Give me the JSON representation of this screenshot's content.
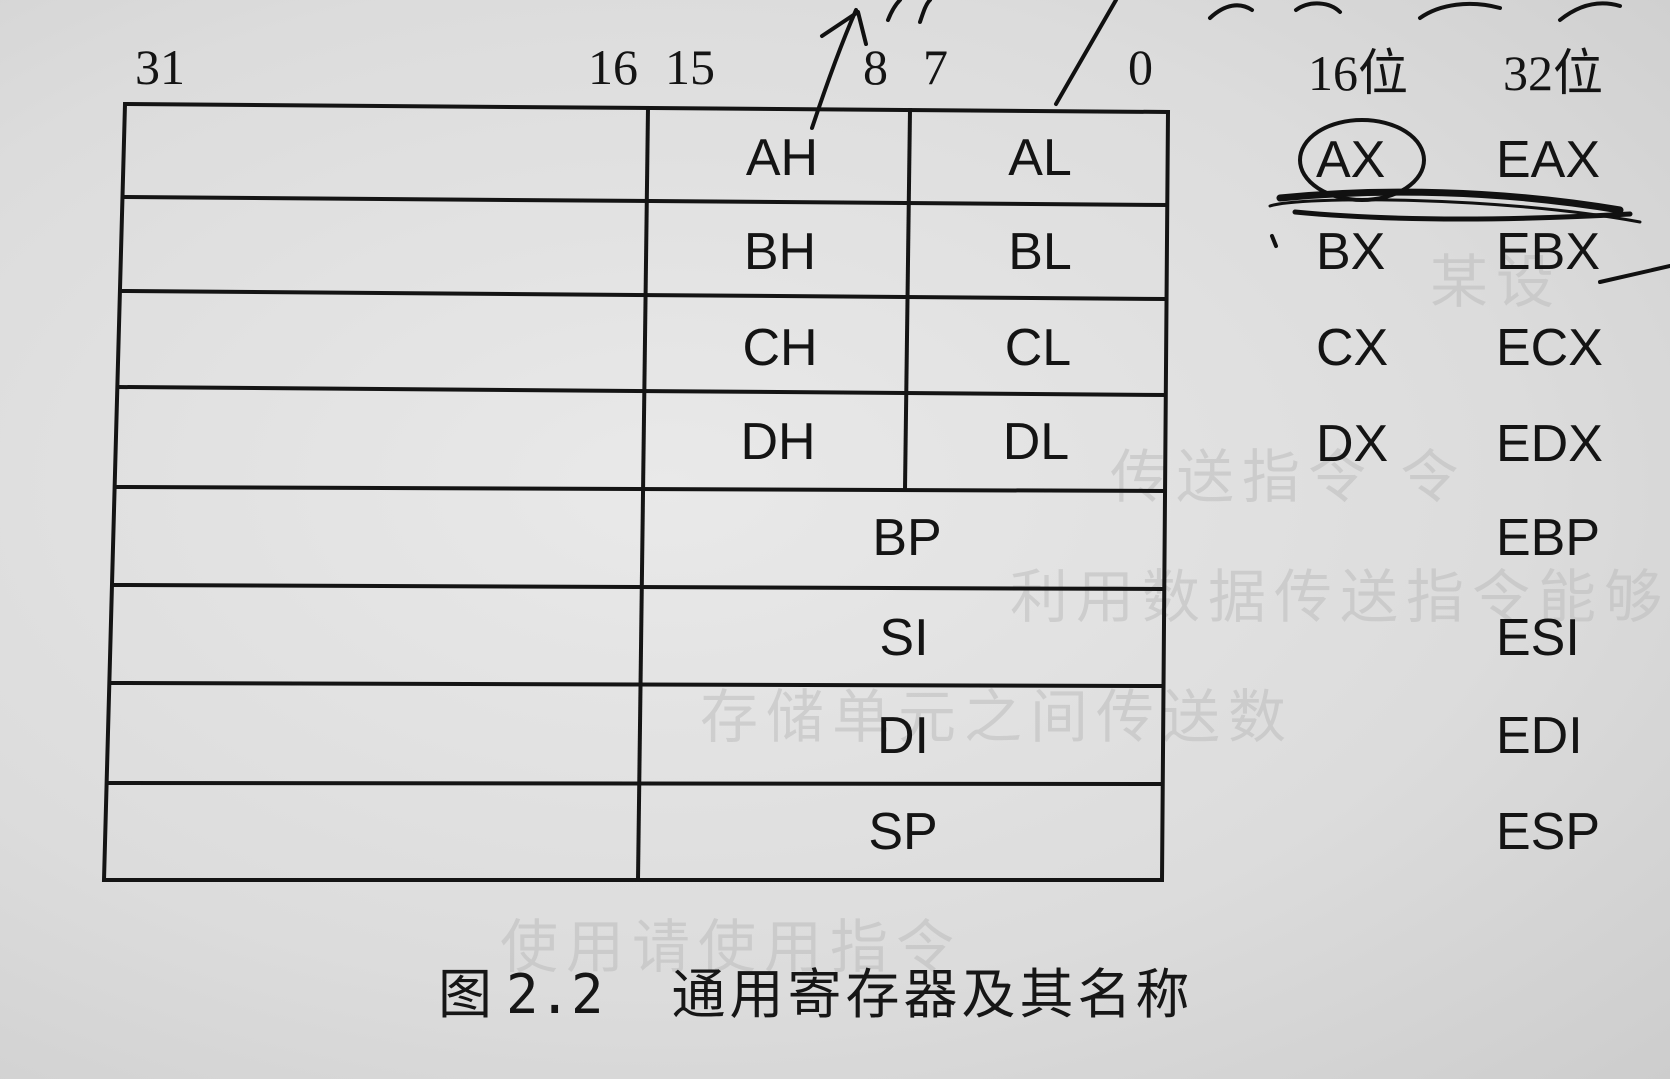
{
  "bit_labels": {
    "b31": "31",
    "b16": "16",
    "b15": "15",
    "b8": "8",
    "b7": "7",
    "b0": "0"
  },
  "headers": {
    "col16": "16位",
    "col32": "32位"
  },
  "registers": {
    "ax": {
      "high": "AH",
      "low": "AL",
      "name16": "AX",
      "name32": "EAX"
    },
    "bx": {
      "high": "BH",
      "low": "BL",
      "name16": "BX",
      "name32": "EBX"
    },
    "cx": {
      "high": "CH",
      "low": "CL",
      "name16": "CX",
      "name32": "ECX"
    },
    "dx": {
      "high": "DH",
      "low": "DL",
      "name16": "DX",
      "name32": "EDX"
    },
    "bp": {
      "name16": "BP",
      "name32": "EBP"
    },
    "si": {
      "name16": "SI",
      "name32": "ESI"
    },
    "di": {
      "name16": "DI",
      "name32": "EDI"
    },
    "sp": {
      "name16": "SP",
      "name32": "ESP"
    }
  },
  "caption": {
    "figure_label": "图",
    "figure_number": "2.2",
    "title": "通用寄存器及其名称"
  },
  "colors": {
    "ink": "#141414",
    "paper": "#dedede"
  }
}
